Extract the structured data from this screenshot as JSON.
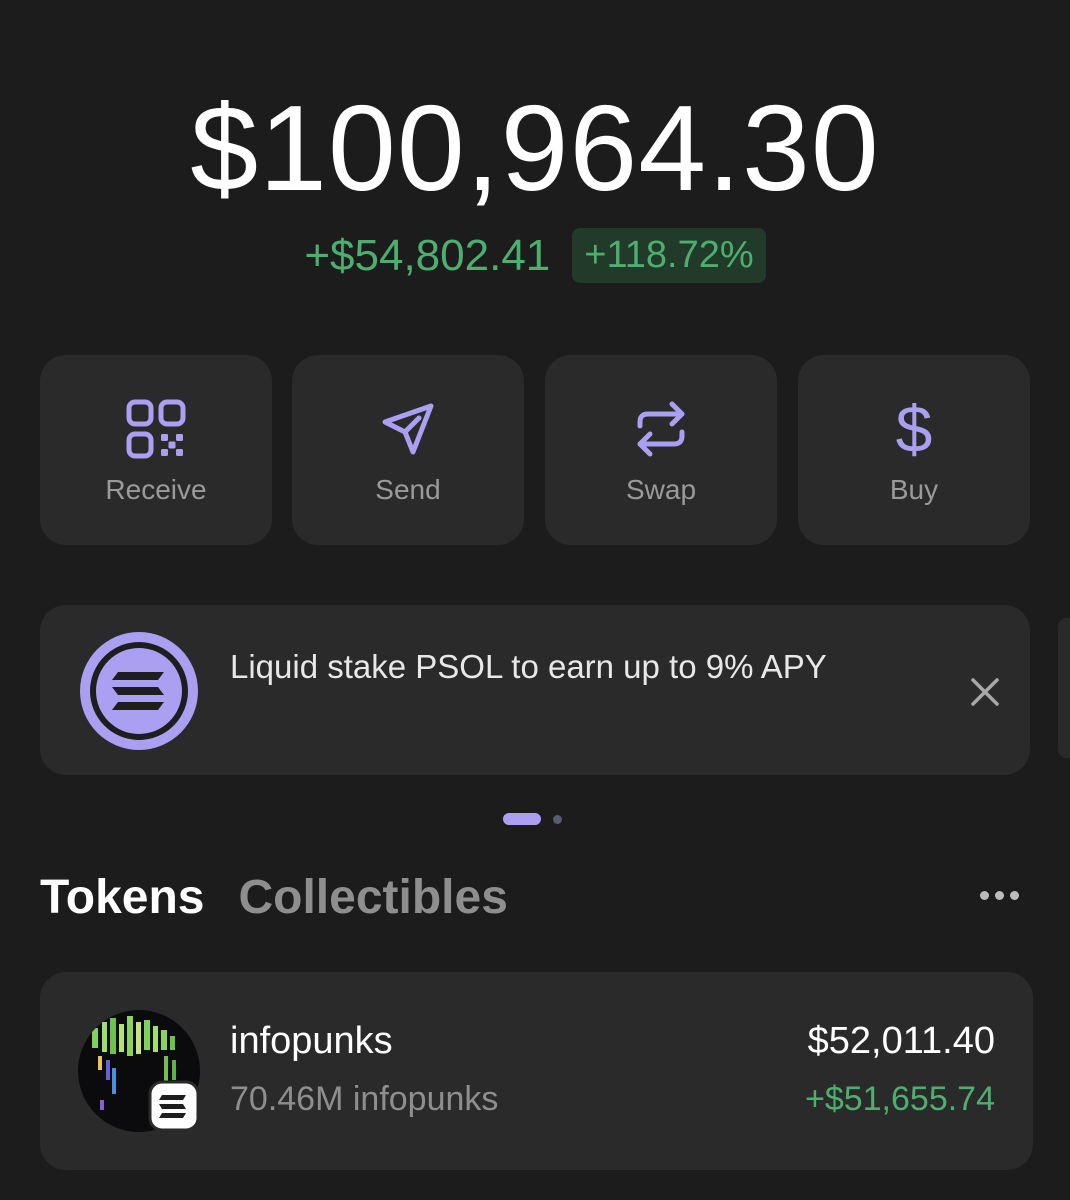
{
  "header": {
    "balance": "$100,964.30",
    "change_amount": "+$54,802.41",
    "change_percent": "+118.72%"
  },
  "actions": [
    {
      "label": "Receive",
      "icon": "qr-code-icon"
    },
    {
      "label": "Send",
      "icon": "paper-plane-icon"
    },
    {
      "label": "Swap",
      "icon": "swap-arrows-icon"
    },
    {
      "label": "Buy",
      "icon": "dollar-icon"
    }
  ],
  "banner": {
    "text": "Liquid stake PSOL to earn up to 9% APY",
    "icon": "solana-icon",
    "close_icon": "close-icon"
  },
  "pagination": {
    "active": 1,
    "total": 2
  },
  "tabs": [
    {
      "label": "Tokens",
      "active": true
    },
    {
      "label": "Collectibles",
      "active": false
    }
  ],
  "tokens": [
    {
      "name": "infopunks",
      "amount": "70.46M infopunks",
      "value": "$52,011.40",
      "change": "+$51,655.74"
    }
  ],
  "colors": {
    "background": "#1c1c1c",
    "card": "#2a2a2a",
    "accent": "#ab9ff2",
    "positive": "#4caf6e",
    "positive_bg": "#213a2a"
  }
}
